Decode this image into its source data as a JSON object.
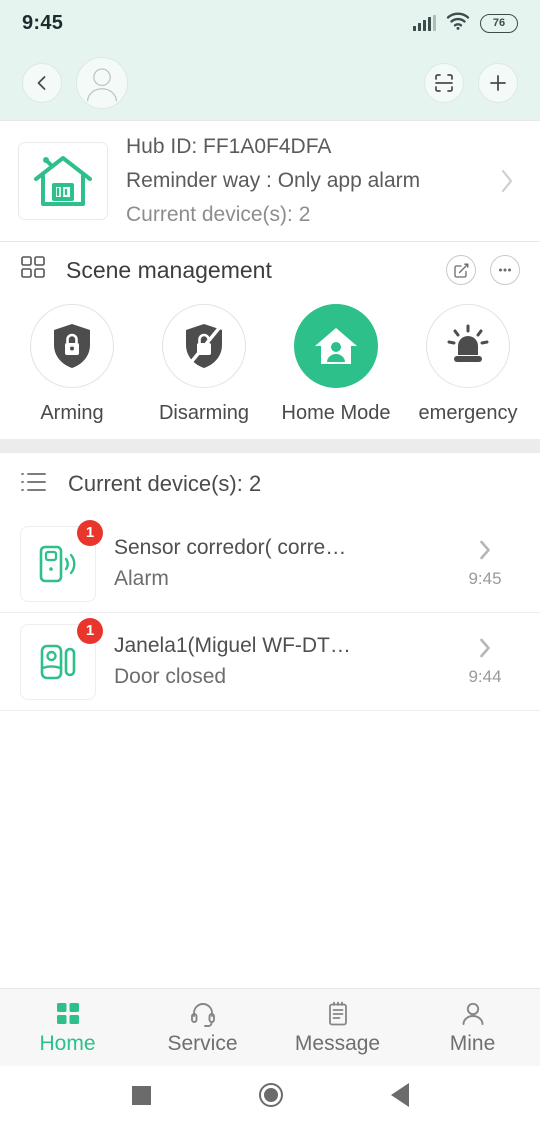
{
  "status_bar": {
    "time": "9:45",
    "battery_level": "76",
    "signal_icon": "cellular-signal-icon",
    "wifi_icon": "wifi-icon"
  },
  "app_bar": {
    "back_icon": "chevron-left-icon",
    "avatar_icon": "user-avatar-icon",
    "scan_icon": "scan-qr-icon",
    "add_icon": "plus-icon"
  },
  "hub_card": {
    "icon": "home-hub-icon",
    "line1": "Hub ID:  FF1A0F4DFA",
    "line2": "Reminder way :  Only app alarm",
    "line3": "Current device(s): 2",
    "chevron_icon": "chevron-right-icon"
  },
  "scene_section": {
    "grid_icon": "grid-icon",
    "title": "Scene management",
    "edit_icon": "edit-square-icon",
    "more_icon": "ellipsis-icon",
    "active_color": "#2ec08a",
    "scenes": [
      {
        "label": "Arming",
        "icon": "shield-lock-icon",
        "active": false
      },
      {
        "label": "Disarming",
        "icon": "shield-unlock-icon",
        "active": false
      },
      {
        "label": "Home Mode",
        "icon": "home-person-icon",
        "active": true
      },
      {
        "label": "emergency",
        "icon": "siren-icon",
        "active": false
      }
    ]
  },
  "devices_section": {
    "list_icon": "list-icon",
    "title": "Current device(s):  2",
    "items": [
      {
        "icon": "motion-sensor-icon",
        "badge": "1",
        "name": "Sensor corredor( corre…",
        "state": "Alarm",
        "time": "9:45",
        "chevron_icon": "chevron-right-icon"
      },
      {
        "icon": "door-contact-sensor-icon",
        "badge": "1",
        "name": "Janela1(Miguel WF-DT…",
        "state": "Door closed",
        "time": "9:44",
        "chevron_icon": "chevron-right-icon"
      }
    ]
  },
  "tab_bar": {
    "tabs": [
      {
        "label": "Home",
        "icon": "grid-icon",
        "active": true
      },
      {
        "label": "Service",
        "icon": "headset-icon",
        "active": false
      },
      {
        "label": "Message",
        "icon": "notepad-icon",
        "active": false
      },
      {
        "label": "Mine",
        "icon": "person-icon",
        "active": false
      }
    ]
  },
  "system_nav": {
    "recents_icon": "square-icon",
    "home_icon": "circle-icon",
    "back_icon": "triangle-back-icon"
  }
}
